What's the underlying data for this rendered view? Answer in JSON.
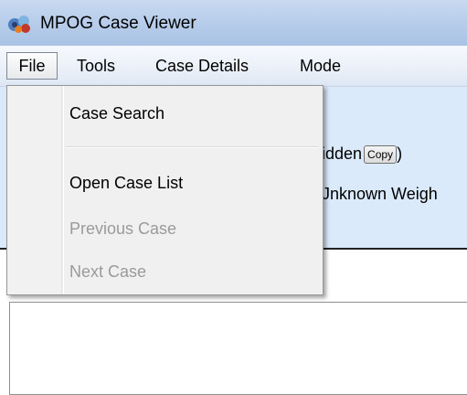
{
  "window": {
    "title": "MPOG Case Viewer",
    "icon": "mpog-app-icon"
  },
  "menubar": {
    "items": [
      {
        "label": "File"
      },
      {
        "label": "Tools"
      },
      {
        "label": "Case Details"
      },
      {
        "label": "Mode"
      }
    ]
  },
  "file_menu": {
    "items": [
      {
        "label": "Case Search",
        "enabled": true
      },
      {
        "label": "Open Case List",
        "enabled": true
      },
      {
        "label": "Previous Case",
        "enabled": false
      },
      {
        "label": "Next Case",
        "enabled": false
      }
    ]
  },
  "background": {
    "line1_text": "idden",
    "copy_label": "Copy",
    "line1_suffix": ")",
    "line2_text": "Jnknown Weigh"
  },
  "colors": {
    "titlebar": "#b7cdea",
    "menubar": "#eaf0f8",
    "info_panel": "#dbeafb",
    "menu_background": "#f0f0f0",
    "disabled_text": "#9a9a9a"
  }
}
